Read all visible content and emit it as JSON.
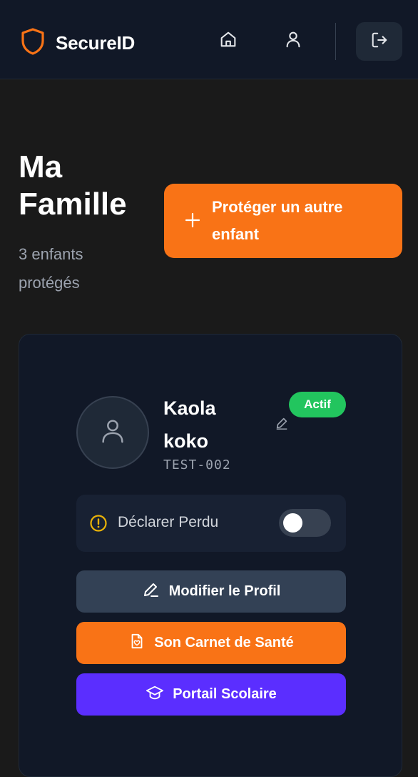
{
  "header": {
    "brand_name": "SecureID",
    "nav": [
      {
        "icon": "home-icon"
      },
      {
        "icon": "user-icon"
      }
    ],
    "logout_icon": "logout-icon",
    "colors": {
      "background": "#111827",
      "brand_accent": "#f97316"
    }
  },
  "page": {
    "title": "Ma Famille",
    "subtitle": "3 enfants protégés",
    "add_button_label": "Protéger un autre enfant"
  },
  "child_card": {
    "name": "Kaola koko",
    "id": "TEST-002",
    "status": "Actif",
    "lost_label": "Déclarer Perdu",
    "lost_toggle_on": false,
    "actions": {
      "edit_profile": "Modifier le Profil",
      "health_record": "Son Carnet de Santé",
      "school_portal": "Portail Scolaire"
    },
    "colors": {
      "status": "#22c55e",
      "warning": "#eab308",
      "edit_button": "#334155",
      "health_button": "#f97316",
      "school_button": "#5b2eff"
    }
  }
}
